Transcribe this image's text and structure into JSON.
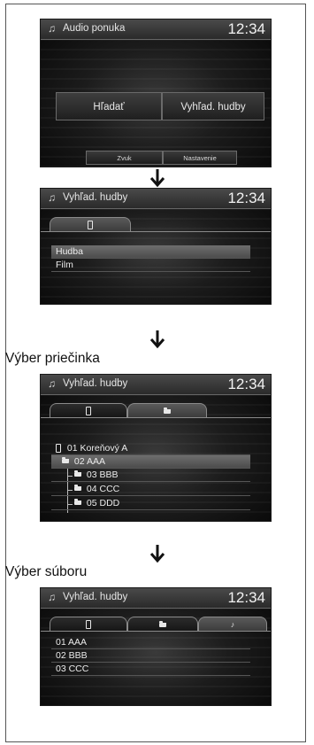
{
  "clock": "12:34",
  "screen1": {
    "title": "Audio ponuka",
    "buttons": [
      "Hľadať",
      "Vyhľad. hudby"
    ],
    "bottom_buttons": [
      "Zvuk",
      "Nastavenie"
    ]
  },
  "screen2": {
    "title": "Vyhľad. hudby",
    "items": [
      "Hudba",
      "Film"
    ]
  },
  "step3": {
    "label": "Výber priečinka",
    "title": "Vyhľad. hudby",
    "items": [
      "01 Koreňový A",
      "02 AAA",
      "03 BBB",
      "04 CCC",
      "05 DDD"
    ]
  },
  "step4": {
    "label": "Výber súboru",
    "title": "Vyhľad. hudby",
    "items": [
      "01 AAA",
      "02 BBB",
      "03 CCC"
    ]
  },
  "icons": {
    "note": "music-note-icon",
    "usb": "usb-icon",
    "folder": "folder-icon",
    "arrow": "down-arrow-icon"
  }
}
